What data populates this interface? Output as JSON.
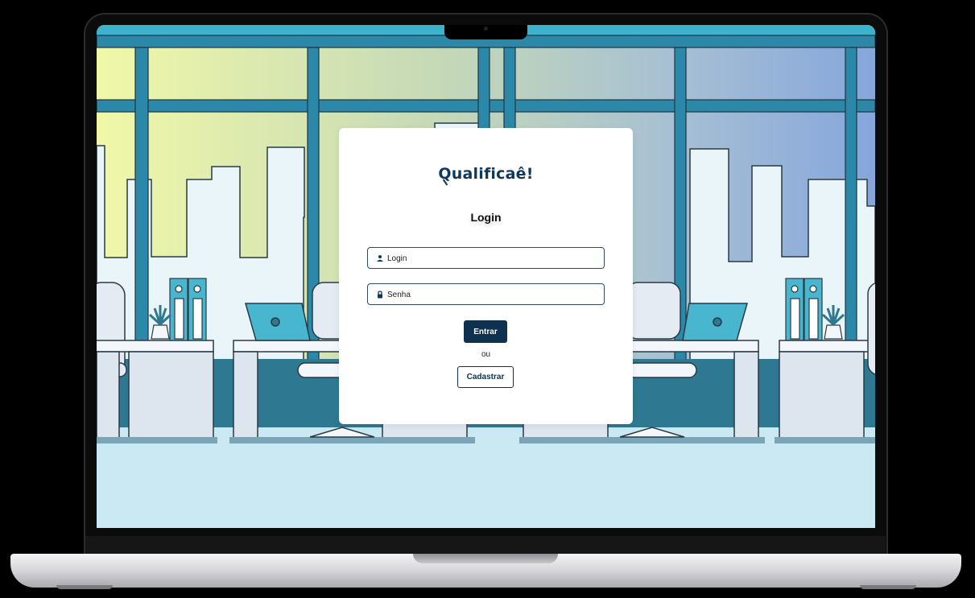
{
  "brand": {
    "logo_text": "Qualificaê!",
    "color": "#10385a"
  },
  "login": {
    "title": "Login",
    "login_placeholder": "Login",
    "password_placeholder": "Senha",
    "submit_label": "Entrar",
    "separator_text": "ou",
    "register_label": "Cadastrar"
  },
  "icons": {
    "login_field": "user-icon",
    "password_field": "lock-icon",
    "logo": "magnifier-icon"
  },
  "colors": {
    "primary": "#0f3150",
    "sky_left": "#eef8a8",
    "sky_right": "#86a8dc",
    "frame": "#2a7f9c",
    "floor": "#c9e8f1"
  }
}
